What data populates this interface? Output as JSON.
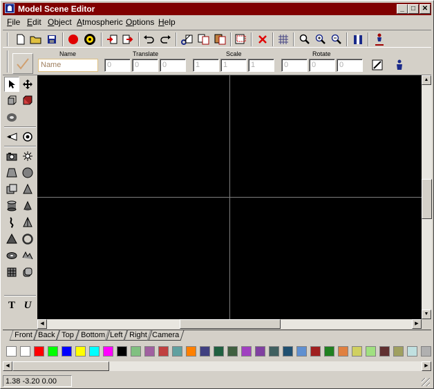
{
  "window": {
    "title": "Model Scene Editor"
  },
  "menu": [
    {
      "label": "File",
      "accel": "F",
      "rest": "ile"
    },
    {
      "label": "Edit",
      "accel": "E",
      "rest": "dit"
    },
    {
      "label": "Object",
      "accel": "O",
      "rest": "bject"
    },
    {
      "label": "Atmospheric",
      "accel": "A",
      "rest": "tmospheric"
    },
    {
      "label": "Options",
      "accel": "O",
      "rest": "ptions"
    },
    {
      "label": "Help",
      "accel": "H",
      "rest": "elp"
    }
  ],
  "toolbar": {
    "icons": [
      "new-file-icon",
      "open-folder-icon",
      "save-icon",
      "record-icon",
      "render-icon",
      "import-icon",
      "export-icon",
      "undo-icon",
      "redo-icon",
      "cut-icon",
      "copy-icon",
      "paste-icon",
      "scene-icon",
      "delete-icon",
      "grid-icon",
      "zoom-icon",
      "zoom-in-icon",
      "zoom-out-icon",
      "properties-icon",
      "figure-icon"
    ]
  },
  "props": {
    "labels": {
      "name": "Name",
      "translate": "Translate",
      "scale": "Scale",
      "rotate": "Rotate"
    },
    "name_placeholder": "Name",
    "translate": [
      "0",
      "0",
      "0"
    ],
    "scale": [
      "1",
      "1",
      "1"
    ],
    "rotate": [
      "0",
      "0",
      "0"
    ]
  },
  "tools": [
    "select-arrow-icon",
    "move-icon",
    "cube-front-icon",
    "cube-red-icon",
    "torus-icon",
    "spotlight-icon",
    "point-target-icon",
    "camera-icon",
    "light-sun-icon",
    "prism-icon",
    "sphere-icon",
    "box-icon",
    "cone-icon",
    "cylinder-icon",
    "cone-small-icon",
    "lathe-icon",
    "pyramid-icon",
    "cone-solid-icon",
    "ring-icon",
    "disc-icon",
    "wave-icon",
    "mesh-grid-icon",
    "rounded-box-icon",
    "text-icon",
    "font-icon"
  ],
  "view_tabs": [
    "Front",
    "Back",
    "Top",
    "Bottom",
    "Left",
    "Right",
    "Camera"
  ],
  "active_view": "Front",
  "palette": [
    "#ffffff",
    "#ffffff",
    "#ff0000",
    "#00ff00",
    "#0000ff",
    "#ffff00",
    "#00ffff",
    "#ff00ff",
    "#000000",
    "#80c080",
    "#a060a0",
    "#c04040",
    "#60a0a0",
    "#ff8000",
    "#404080",
    "#206040",
    "#406040",
    "#a040c0",
    "#8040a0",
    "#406060",
    "#205070",
    "#6090d0",
    "#a02020",
    "#208020",
    "#e08040",
    "#d0d060",
    "#a0e080",
    "#603030",
    "#a0a060",
    "#c0e0e0",
    "#b0b0b0"
  ],
  "status": {
    "coords": "1.38 -3.20 0.00"
  }
}
